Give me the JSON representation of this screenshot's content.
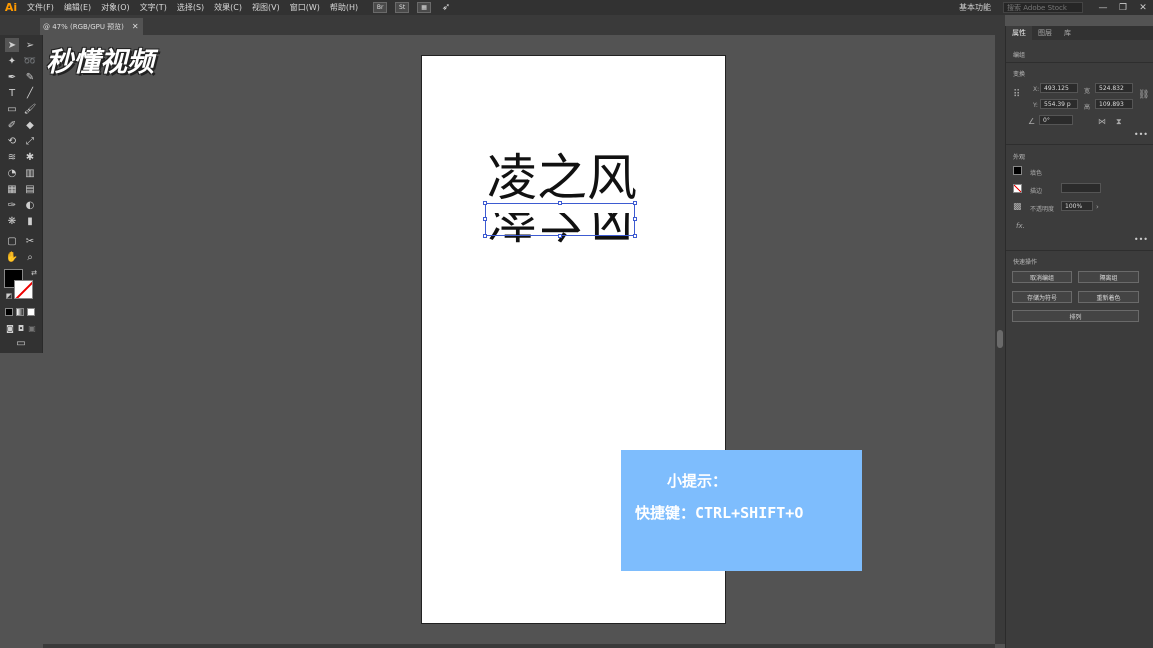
{
  "app": {
    "logo": "Ai"
  },
  "menu": [
    "文件(F)",
    "编辑(E)",
    "对象(O)",
    "文字(T)",
    "选择(S)",
    "效果(C)",
    "视图(V)",
    "窗口(W)",
    "帮助(H)"
  ],
  "menu_icons": [
    "Br",
    "St"
  ],
  "window": {
    "workspace": "基本功能",
    "search_placeholder": "搜索 Adobe Stock",
    "minimize": "—",
    "restore": "❐",
    "close": "✕"
  },
  "document_tab": {
    "label": "@ 47% (RGB/GPU 预览)",
    "close": "✕"
  },
  "watermark": "秒懂视频",
  "artboard": {
    "text": "凌之风",
    "reflected_text": "凌之风"
  },
  "tip": {
    "title": "小提示：",
    "body": "快捷键：CTRL+SHIFT+O"
  },
  "panel": {
    "tabs": [
      "属性",
      "图层",
      "库"
    ],
    "group_label": "编组",
    "transform_label": "变换",
    "x_label": "X:",
    "x_value": "493.125",
    "y_label": "Y:",
    "y_value": "554.39 p",
    "w_label": "宽",
    "w_value": "524.832",
    "h_label": "高",
    "h_value": "109.893",
    "angle_value": "0°",
    "appearance_label": "外观",
    "fill_label": "填色",
    "stroke_label": "描边",
    "opacity_label": "不透明度",
    "opacity_value": "100%",
    "fx_label": "fx.",
    "quick_actions_label": "快速操作",
    "btn_ungroup": "取消编组",
    "btn_isolate": "隔离组",
    "btn_save_symbol": "存储为符号",
    "btn_recolor": "重新着色",
    "btn_arrange": "排列",
    "more": "•••"
  },
  "colors": {
    "tip_bg": "#7ebdfd",
    "selection": "#3d5bd1",
    "ai_orange": "#ff9a00"
  }
}
